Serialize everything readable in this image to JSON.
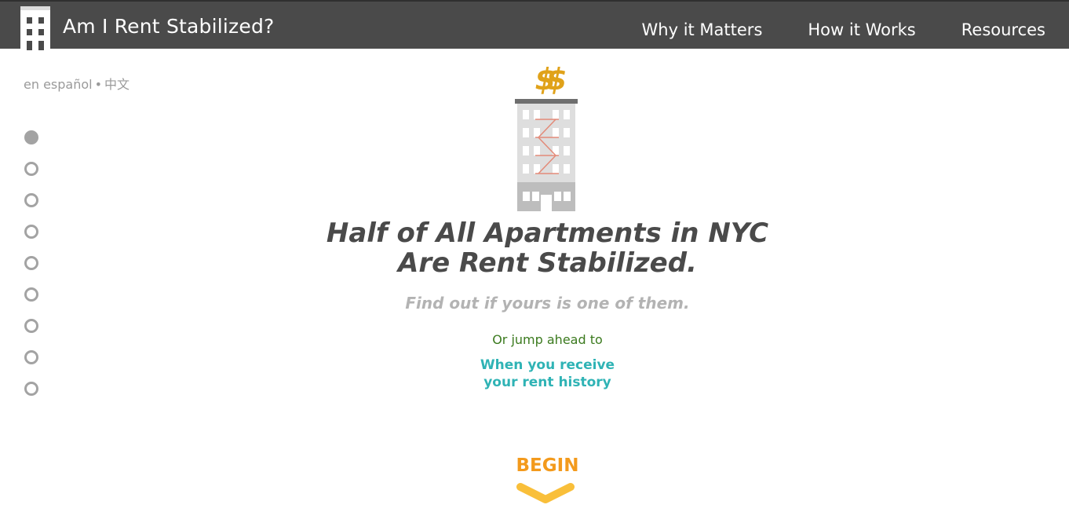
{
  "header": {
    "title": "Am I Rent Stabilized?",
    "nav": [
      "Why it Matters",
      "How it Works",
      "Resources"
    ]
  },
  "language": {
    "spanish": "en español",
    "separator": "•",
    "chinese": "中文"
  },
  "progress": {
    "total_steps": 9,
    "current_step": 1
  },
  "hero": {
    "dollar_symbol": "$$",
    "headline_line1": "Half of All Apartments in NYC",
    "headline_line2": "Are Rent Stabilized.",
    "subheadline": "Find out if yours is one of them.",
    "jump_prompt": "Or jump ahead to",
    "jump_link_line1": "When you receive",
    "jump_link_line2": "your rent history",
    "begin_label": "BEGIN"
  },
  "colors": {
    "header_bg": "#4a4a4a",
    "accent_orange": "#f39a1c",
    "link_teal": "#2fb3b5",
    "prompt_green": "#3b7a1e",
    "dollar_gold": "#e0a21a",
    "fire_escape": "#e38a78"
  },
  "icons": [
    "building-logo-icon",
    "building-illustration-icon",
    "chevron-down-icon"
  ]
}
